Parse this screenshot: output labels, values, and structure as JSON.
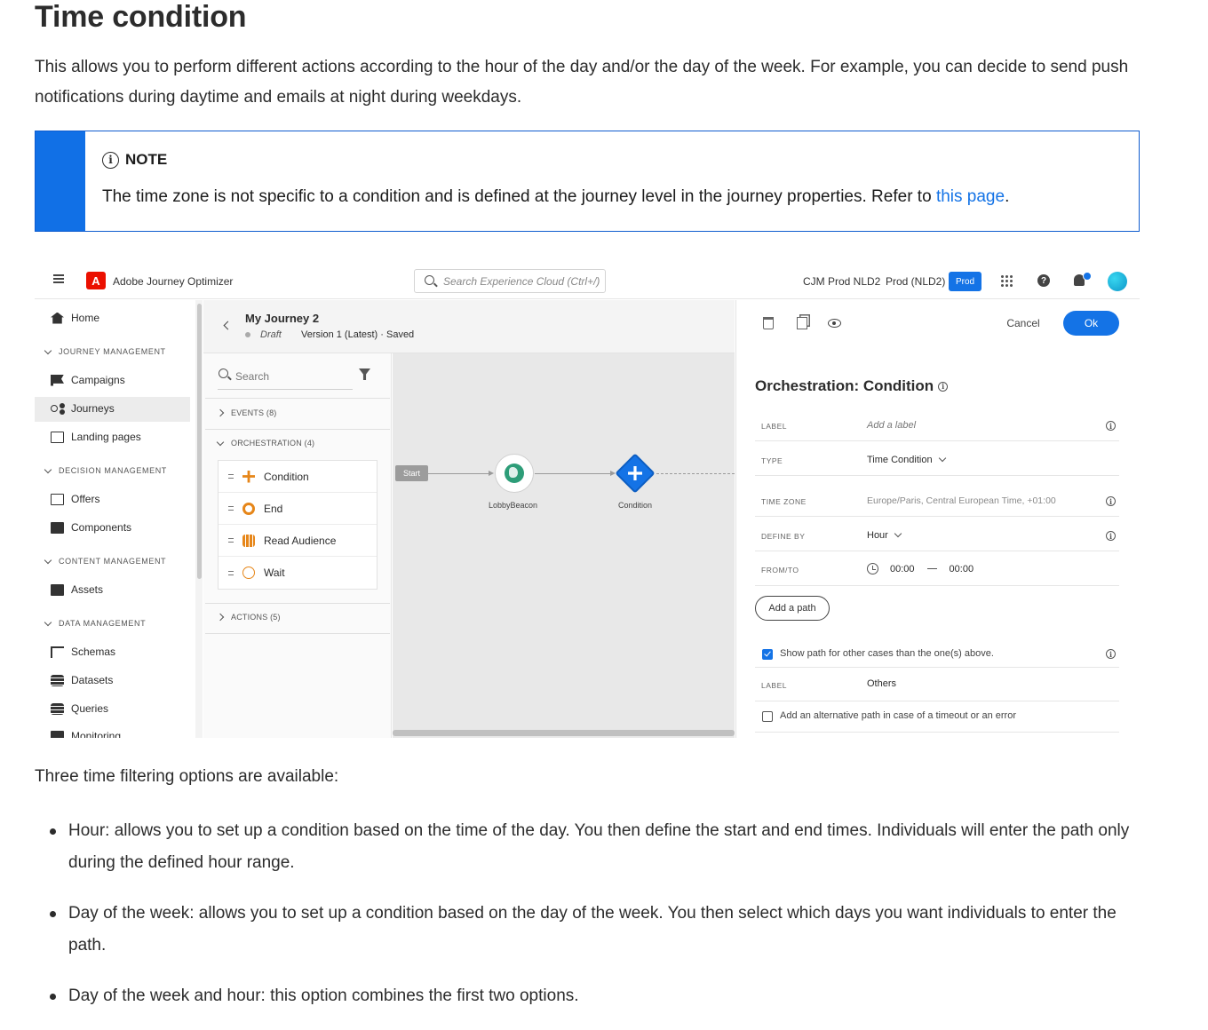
{
  "doc": {
    "heading": "Time condition",
    "intro": "This allows you to perform different actions according to the hour of the day and/or the day of the week. For example, you can decide to send push notifications during daytime and emails at night during weekdays.",
    "note": {
      "title": "NOTE",
      "text_before": "The time zone is not specific to a condition and is defined at the journey level in the journey properties. Refer to ",
      "link": "this page",
      "text_after": "."
    },
    "options_intro": "Three time filtering options are available:",
    "options": [
      "Hour: allows you to set up a condition based on the time of the day. You then define the start and end times. Individuals will enter the path only during the defined hour range.",
      "Day of the week: allows you to set up a condition based on the day of the week. You then select which days you want individuals to enter the path.",
      "Day of the week and hour: this option combines the first two options."
    ]
  },
  "app": {
    "logo_letter": "A",
    "name": "Adobe Journey Optimizer",
    "search_placeholder": "Search Experience Cloud (Ctrl+/)",
    "org": "CJM Prod NLD2",
    "sandbox": "Prod (NLD2)",
    "sandbox_badge": "Prod",
    "help_glyph": "?"
  },
  "sidebar": {
    "home": "Home",
    "sections": [
      {
        "title": "JOURNEY MANAGEMENT",
        "items": [
          "Campaigns",
          "Journeys",
          "Landing pages"
        ]
      },
      {
        "title": "DECISION MANAGEMENT",
        "items": [
          "Offers",
          "Components"
        ]
      },
      {
        "title": "CONTENT MANAGEMENT",
        "items": [
          "Assets"
        ]
      },
      {
        "title": "DATA MANAGEMENT",
        "items": [
          "Schemas",
          "Datasets",
          "Queries",
          "Monitoring"
        ]
      }
    ]
  },
  "journey": {
    "title": "My Journey 2",
    "status": "Draft",
    "version": "Version 1 (Latest) · Saved"
  },
  "palette": {
    "search_placeholder": "Search",
    "events": "EVENTS (8)",
    "orchestration": "ORCHESTRATION (4)",
    "items": [
      "Condition",
      "End",
      "Read Audience",
      "Wait"
    ],
    "actions": "ACTIONS (5)"
  },
  "canvas": {
    "start": "Start",
    "node1": "LobbyBeacon",
    "node2": "Condition"
  },
  "panel": {
    "cancel": "Cancel",
    "ok": "Ok",
    "title": "Orchestration: Condition",
    "label_label": "LABEL",
    "label_placeholder": "Add a label",
    "type_label": "TYPE",
    "type_value": "Time Condition",
    "tz_label": "TIME ZONE",
    "tz_value": "Europe/Paris, Central European Time, +01:00",
    "define_label": "DEFINE BY",
    "define_value": "Hour",
    "fromto_label": "FROM/TO",
    "from": "00:00",
    "to": "00:00",
    "add_path": "Add a path",
    "show_path": "Show path for other cases than the one(s) above.",
    "other_label": "LABEL",
    "other_value": "Others",
    "alt_path": "Add an alternative path in case of a timeout or an error"
  },
  "colors": {
    "accent": "#1473e6",
    "note_bar": "#1170e6",
    "orange": "#e68619"
  }
}
